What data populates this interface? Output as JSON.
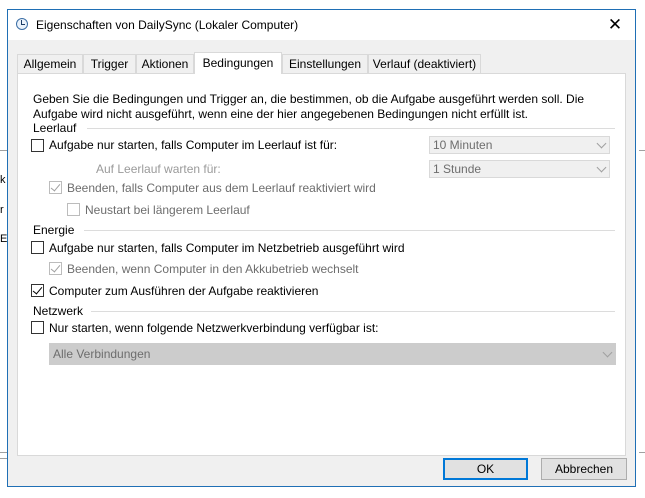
{
  "window": {
    "title": "Eigenschaften von DailySync (Lokaler Computer)",
    "close_glyph": "✕"
  },
  "tabs": [
    {
      "label": "Allgemein"
    },
    {
      "label": "Trigger"
    },
    {
      "label": "Aktionen"
    },
    {
      "label": "Bedingungen"
    },
    {
      "label": "Einstellungen"
    },
    {
      "label": "Verlauf (deaktiviert)"
    }
  ],
  "active_tab": "Bedingungen",
  "description": "Geben Sie die Bedingungen und Trigger an, die bestimmen, ob die Aufgabe ausgeführt werden soll. Die Aufgabe wird nicht ausgeführt, wenn eine der hier angegebenen Bedingungen nicht erfüllt ist.",
  "idle": {
    "group_label": "Leerlauf",
    "start_if_idle": {
      "label": "Aufgabe nur starten, falls Computer im Leerlauf ist für:",
      "checked": false
    },
    "idle_duration": "10 Minuten",
    "wait_label": "Auf Leerlauf warten für:",
    "wait_duration": "1 Stunde",
    "stop_if_resumed": {
      "label": "Beenden, falls Computer aus dem Leerlauf reaktiviert wird",
      "checked": true
    },
    "restart_if_idle": {
      "label": "Neustart bei längerem Leerlauf",
      "checked": false
    }
  },
  "power": {
    "group_label": "Energie",
    "start_on_ac": {
      "label": "Aufgabe nur starten, falls Computer im Netzbetrieb ausgeführt wird",
      "checked": false
    },
    "stop_on_battery": {
      "label": "Beenden, wenn Computer in den Akkubetrieb wechselt",
      "checked": true
    },
    "wake_to_run": {
      "label": "Computer zum Ausführen der Aufgabe reaktivieren",
      "checked": true
    }
  },
  "network": {
    "group_label": "Netzwerk",
    "start_if_network": {
      "label": "Nur starten, wenn folgende Netzwerkverbindung verfügbar ist:",
      "checked": false
    },
    "connection": "Alle Verbindungen"
  },
  "buttons": {
    "ok": "OK",
    "cancel": "Abbrechen"
  },
  "background": {
    "fragments": [
      "k",
      "r",
      "Ei"
    ]
  }
}
